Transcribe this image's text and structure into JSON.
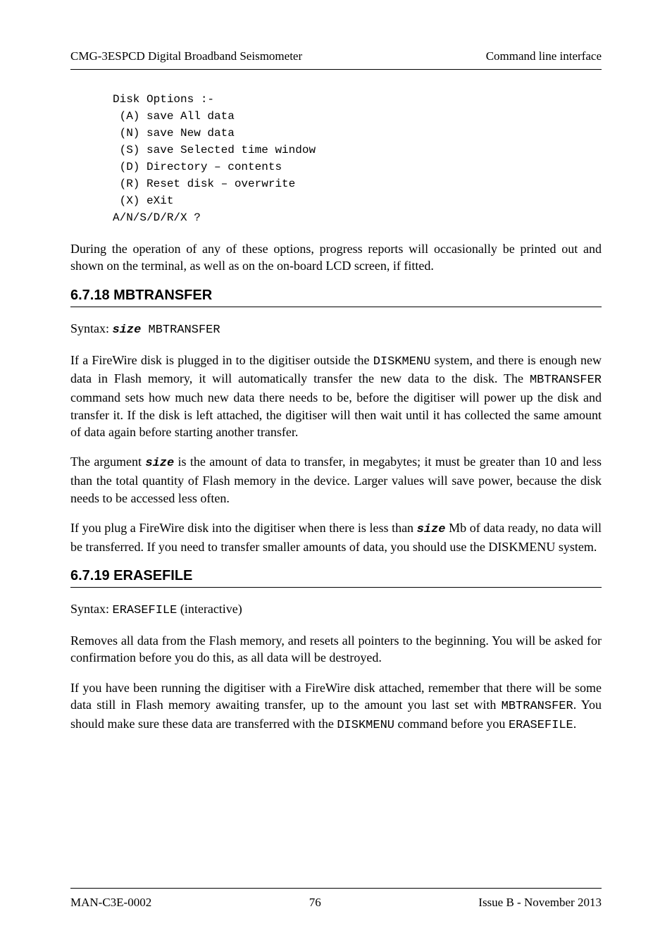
{
  "header": {
    "left": "CMG-3ESPCD Digital Broadband Seismometer",
    "right": "Command line interface"
  },
  "code_block": "Disk Options :-\n (A) save All data\n (N) save New data\n (S) save Selected time window\n (D) Directory – contents\n (R) Reset disk – overwrite\n (X) eXit\nA/N/S/D/R/X ?",
  "para1": "During the operation of any of these options, progress reports will occasionally be printed out and shown on the terminal, as well as on the on-board LCD screen, if fitted.",
  "section1_heading": "6.7.18 MBTRANSFER",
  "syntax1_prefix": "Syntax: ",
  "syntax1_var": "size",
  "syntax1_cmd": " MBTRANSFER",
  "para2_a": "If a FireWire disk is plugged in to the digitiser outside the ",
  "para2_code1": "DISKMENU",
  "para2_b": " system, and there is enough new data in Flash memory, it will automatically transfer the new data to the disk.  The ",
  "para2_code2": "MBTRANSFER",
  "para2_c": " command sets how much new data there needs to be, before the digitiser will power up the disk and transfer it. If the disk is left attached, the digitiser will then wait until it has collected the same amount of data again before starting another transfer.",
  "para3_a": "The argument ",
  "para3_var": "size",
  "para3_b": " is the amount of data to transfer, in megabytes; it must be greater than 10 and less than the total quantity of Flash memory in the device. Larger values will save power, because the disk needs to be accessed less often.",
  "para4_a": "If you plug a FireWire disk into the digitiser when there is less than ",
  "para4_var": "size",
  "para4_b": " Mb of data ready, no data will be transferred.  If you need to transfer smaller amounts of data, you should use the DISKMENU system.",
  "section2_heading": "6.7.19 ERASEFILE",
  "syntax2_prefix": "Syntax: ",
  "syntax2_cmd": "ERASEFILE",
  "syntax2_suffix": " (interactive)",
  "para5": "Removes all data from the Flash memory, and resets all pointers to the beginning.  You will be asked for confirmation before you do this, as all data will be destroyed.",
  "para6_a": "If you have been running the digitiser with a FireWire disk attached, remember that there will be some data still in Flash memory awaiting transfer, up to the amount you last set with ",
  "para6_code1": "MBTRANSFER",
  "para6_b": ".  You should make sure these data are transferred with the ",
  "para6_code2": "DISKMENU",
  "para6_c": " command before you ",
  "para6_code3": "ERASEFILE",
  "para6_d": ".",
  "footer": {
    "left": "MAN-C3E-0002",
    "center": "76",
    "right": "Issue B  - November 2013"
  }
}
